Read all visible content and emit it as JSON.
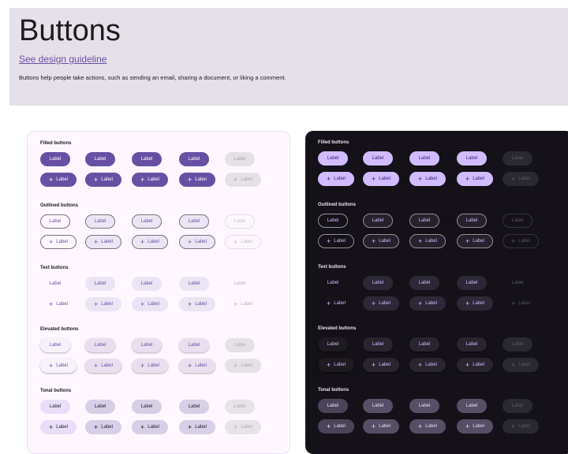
{
  "header": {
    "title": "Buttons",
    "guideline_link": "See design guideline",
    "description": "Buttons help people take actions, such as sending an email, sharing a document, or liking a comment."
  },
  "labels": {
    "label": "Label",
    "plus": "+"
  },
  "sections": {
    "filled": "Filled buttons",
    "outlined": "Outlined buttons",
    "text": "Text buttons",
    "elevated": "Elevated buttons",
    "tonal": "Tonal buttons"
  },
  "themes": {
    "light_primary": "#6750a4",
    "dark_primary": "#d0bcff",
    "dark_background": "#141218",
    "light_background": "#fef7ff"
  },
  "button_states": [
    "enabled",
    "hovered",
    "focused",
    "pressed",
    "disabled"
  ],
  "icons": {
    "add": "add-icon"
  }
}
